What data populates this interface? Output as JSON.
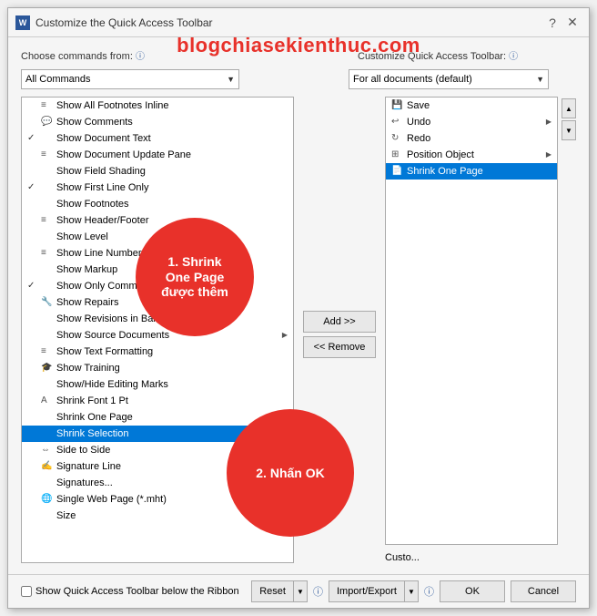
{
  "dialog": {
    "title": "Customize the Quick Access Toolbar",
    "watermark": "blogchiasekienthuc.com"
  },
  "titlebar": {
    "help_label": "?",
    "close_label": "✕"
  },
  "left_section": {
    "label": "Choose commands from:",
    "info_icon": "ⓘ",
    "dropdown_value": "All Commands",
    "dropdown_arrow": "▼"
  },
  "right_section": {
    "label": "Customize Quick Access Toolbar:",
    "info_icon": "ⓘ",
    "dropdown_value": "For all documents (default)",
    "dropdown_arrow": "▼"
  },
  "left_list_items": [
    {
      "check": "",
      "icon": "≡",
      "label": "Show All Footnotes Inline",
      "has_sub": false
    },
    {
      "check": "",
      "icon": "💬",
      "label": "Show Comments",
      "has_sub": false
    },
    {
      "check": "✓",
      "icon": "",
      "label": "Show Document Text",
      "has_sub": false
    },
    {
      "check": "",
      "icon": "≡",
      "label": "Show Document Update Pane",
      "has_sub": false
    },
    {
      "check": "",
      "icon": "",
      "label": "Show Field Shading",
      "has_sub": false
    },
    {
      "check": "✓",
      "icon": "",
      "label": "Show First Line Only",
      "has_sub": false
    },
    {
      "check": "",
      "icon": "",
      "label": "Show Footnotes",
      "has_sub": false
    },
    {
      "check": "",
      "icon": "≡",
      "label": "Show Header/Footer",
      "has_sub": false
    },
    {
      "check": "",
      "icon": "",
      "label": "Show Level",
      "has_sub": false
    },
    {
      "check": "",
      "icon": "≡",
      "label": "Show Line Numbers",
      "has_sub": false
    },
    {
      "check": "",
      "icon": "",
      "label": "Show Markup",
      "has_sub": false
    },
    {
      "check": "✓",
      "icon": "",
      "label": "Show Only Comments",
      "has_sub": false
    },
    {
      "check": "",
      "icon": "🔧",
      "label": "Show Repairs",
      "has_sub": false
    },
    {
      "check": "",
      "icon": "",
      "label": "Show Revisions in Balloons",
      "has_sub": false
    },
    {
      "check": "",
      "icon": "",
      "label": "Show Source Documents",
      "has_sub": true
    },
    {
      "check": "",
      "icon": "≡",
      "label": "Show Text Formatting",
      "has_sub": false
    },
    {
      "check": "",
      "icon": "🎓",
      "label": "Show Training",
      "has_sub": false
    },
    {
      "check": "",
      "icon": "",
      "label": "Show/Hide Editing Marks",
      "has_sub": false
    },
    {
      "check": "",
      "icon": "A",
      "label": "Shrink Font 1 Pt",
      "has_sub": false
    },
    {
      "check": "",
      "icon": "",
      "label": "Shrink One Page",
      "has_sub": false
    },
    {
      "check": "",
      "icon": "",
      "label": "Shrink Selection",
      "has_sub": false,
      "selected": true
    },
    {
      "check": "",
      "icon": "⇔",
      "label": "Side to Side",
      "has_sub": false
    },
    {
      "check": "",
      "icon": "✍",
      "label": "Signature Line",
      "has_sub": false
    },
    {
      "check": "",
      "icon": "",
      "label": "Signatures...",
      "has_sub": false
    },
    {
      "check": "",
      "icon": "🌐",
      "label": "Single Web Page (*.mht)",
      "has_sub": false
    },
    {
      "check": "",
      "icon": "",
      "label": "Size",
      "has_sub": false
    }
  ],
  "middle_buttons": {
    "add_label": "Add >>",
    "remove_label": "<< Remove"
  },
  "right_list_items": [
    {
      "icon": "💾",
      "label": "Save",
      "has_sub": false
    },
    {
      "icon": "↩",
      "label": "Undo",
      "has_sub": true
    },
    {
      "icon": "↻",
      "label": "Redo",
      "has_sub": false
    },
    {
      "icon": "⊞",
      "label": "Position Object",
      "has_sub": true
    },
    {
      "icon": "📄",
      "label": "Shrink One Page",
      "has_sub": false,
      "selected": true
    }
  ],
  "scroll_buttons": {
    "up": "▲",
    "down": "▼"
  },
  "separator": {
    "customize_label": "Custo..."
  },
  "bottom": {
    "checkbox_label": "Show Quick Access Toolbar below the Ribbon",
    "reset_label": "Reset",
    "reset_arrow": "▼",
    "import_export_label": "Import/Export",
    "import_export_arrow": "▼",
    "info_icon": "ⓘ",
    "ok_label": "OK",
    "cancel_label": "Cancel"
  },
  "annotations": {
    "bubble1_line1": "1. Shrink",
    "bubble1_line2": "One Page",
    "bubble1_line3": "được thêm",
    "bubble2_line1": "2. Nhấn OK"
  }
}
